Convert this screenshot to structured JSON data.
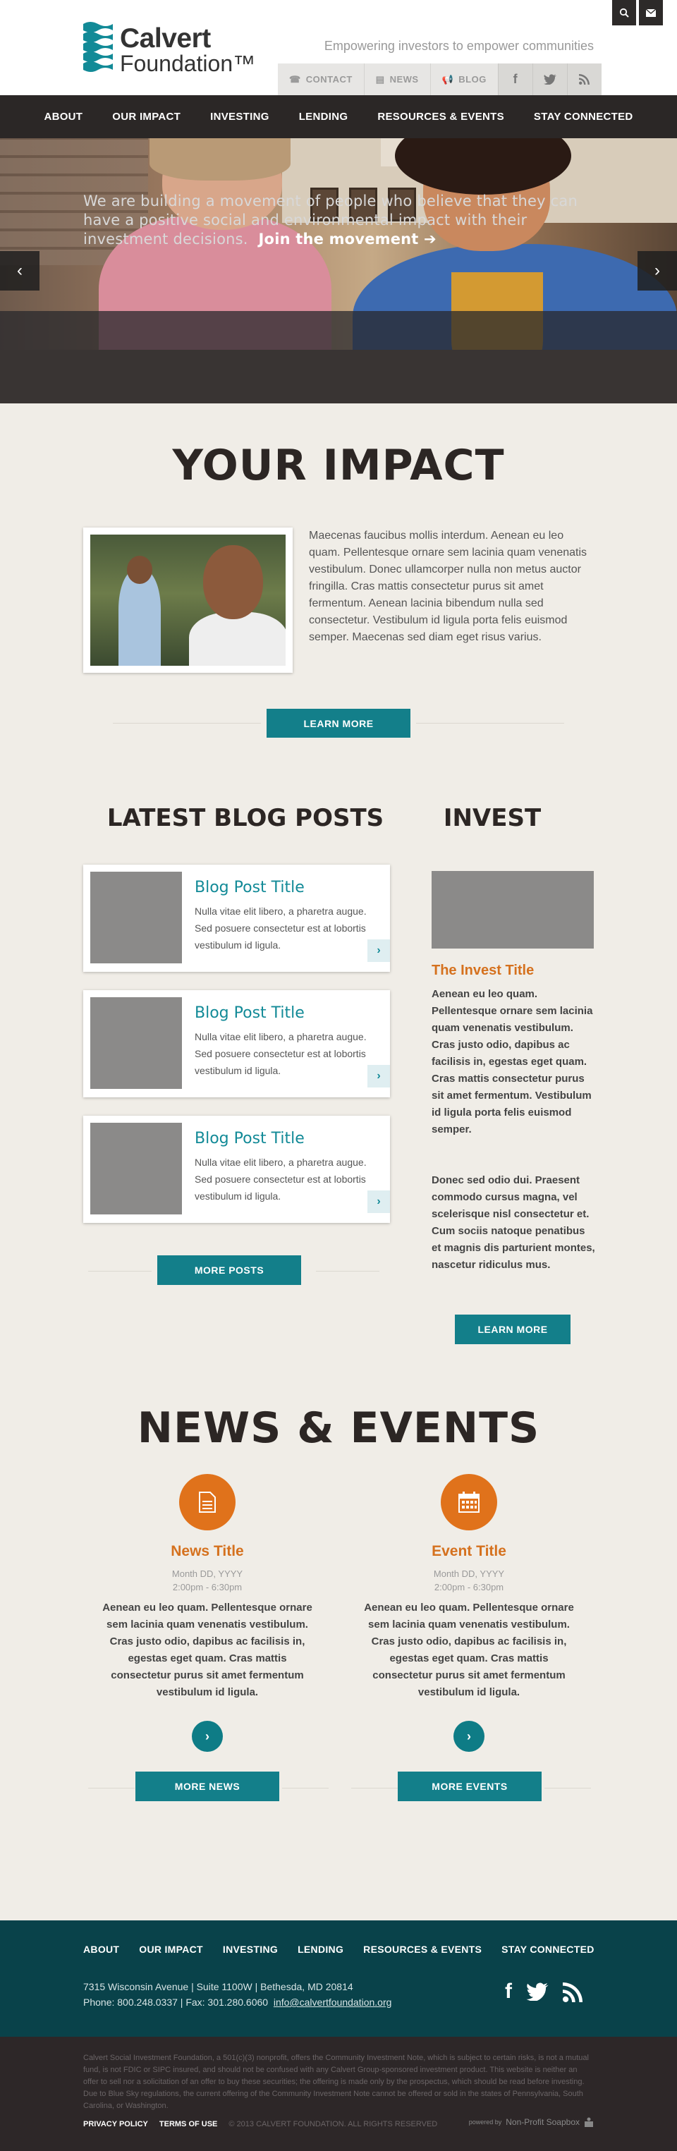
{
  "header": {
    "logo_line1": "Calvert",
    "logo_line2": "Foundation™",
    "tagline": "Empowering investors to empower communities",
    "search_icon": "search-icon",
    "email_icon": "envelope-icon",
    "utility": [
      {
        "label": "CONTACT",
        "icon": "phone-icon"
      },
      {
        "label": "NEWS",
        "icon": "newspaper-icon"
      },
      {
        "label": "BLOG",
        "icon": "megaphone-icon"
      }
    ],
    "social": [
      "facebook-icon",
      "twitter-icon",
      "rss-icon"
    ]
  },
  "nav": [
    "ABOUT",
    "OUR IMPACT",
    "INVESTING",
    "LENDING",
    "RESOURCES & EVENTS",
    "STAY CONNECTED"
  ],
  "hero": {
    "caption": "We are building a movement of people who believe that they can have a positive social and environmental impact with their investment decisions.",
    "cta": "Join the movement ➔",
    "prev": "‹",
    "next": "›"
  },
  "impact": {
    "title": "YOUR IMPACT",
    "text": "Maecenas faucibus mollis interdum. Aenean eu leo quam. Pellentesque ornare sem lacinia quam venenatis vestibulum. Donec ullamcorper nulla non metus auctor fringilla. Cras mattis consectetur purus sit amet fermentum. Aenean lacinia bibendum nulla sed consectetur. Vestibulum id ligula porta felis euismod semper. Maecenas sed diam eget risus varius.",
    "button": "LEARN MORE"
  },
  "blog": {
    "title": "LATEST BLOG POSTS",
    "posts": [
      {
        "title": "Blog Post Title",
        "excerpt": "Nulla vitae elit libero, a pharetra augue. Sed posuere consectetur est at lobortis vestibulum id ligula."
      },
      {
        "title": "Blog Post Title",
        "excerpt": "Nulla vitae elit libero, a pharetra augue. Sed posuere consectetur est at lobortis vestibulum id ligula."
      },
      {
        "title": "Blog Post Title",
        "excerpt": "Nulla vitae elit libero, a pharetra augue. Sed posuere consectetur est at lobortis vestibulum id ligula."
      }
    ],
    "button": "MORE POSTS"
  },
  "invest": {
    "title": "INVEST",
    "subtitle": "The Invest Title",
    "p1": "Aenean eu leo quam. Pellentesque ornare sem lacinia quam venenatis vestibulum. Cras justo odio, dapibus ac facilisis in, egestas eget quam. Cras mattis consectetur purus sit amet fermentum. Vestibulum id ligula porta felis euismod semper.",
    "p2": "Donec sed odio dui. Praesent commodo cursus magna, vel scelerisque nisl consectetur et. Cum sociis natoque penatibus et magnis dis parturient montes, nascetur ridiculus mus.",
    "button": "LEARN MORE"
  },
  "news_events": {
    "title": "NEWS & EVENTS",
    "news": {
      "icon": "document-icon",
      "title": "News Title",
      "date": "Month DD, YYYY",
      "time": "2:00pm - 6:30pm",
      "text": "Aenean eu leo quam. Pellentesque ornare sem lacinia quam venenatis vestibulum. Cras justo odio, dapibus ac facilisis in, egestas eget quam. Cras mattis consectetur purus sit amet fermentum vestibulum id ligula.",
      "button": "MORE NEWS"
    },
    "event": {
      "icon": "calendar-icon",
      "title": "Event Title",
      "date": "Month DD, YYYY",
      "time": "2:00pm - 6:30pm",
      "text": "Aenean eu leo quam. Pellentesque ornare sem lacinia quam venenatis vestibulum. Cras justo odio, dapibus ac facilisis in, egestas eget quam. Cras mattis consectetur purus sit amet fermentum vestibulum id ligula.",
      "button": "MORE EVENTS"
    }
  },
  "footer": {
    "nav": [
      "ABOUT",
      "OUR IMPACT",
      "INVESTING",
      "LENDING",
      "RESOURCES & EVENTS",
      "STAY CONNECTED"
    ],
    "address": "7315 Wisconsin Avenue  |  Suite 1100W  |  Bethesda, MD 20814",
    "phone": "Phone: 800.248.0337  |  Fax: 301.280.6060",
    "email": "info@calvertfoundation.org",
    "disclaimer": "Calvert Social Investment Foundation, a 501(c)(3) nonprofit, offers the Community Investment Note, which is subject to certain risks, is not a mutual fund, is not FDIC or SIPC insured, and should not be confused with any Calvert Group-sponsored investment product. This website is neither an offer to sell nor a solicitation of an offer to buy these securities; the offering is made only by the prospectus, which should be read before investing. Due to Blue Sky regulations, the current offering of the Community Investment Note cannot be offered or sold in the states of Pennsylvania, South Carolina, or Washington.",
    "privacy": "PRIVACY POLICY",
    "terms": "TERMS OF USE",
    "copyright": "© 2013 CALVERT FOUNDATION. ALL RIGHTS RESERVED",
    "powered_label": "powered by",
    "powered_name": "Non-Profit Soapbox"
  },
  "colors": {
    "teal_button": "#137f8a",
    "orange_accent": "#e0721b",
    "nav_dark": "#2b2726",
    "footer_teal": "#09424a"
  }
}
